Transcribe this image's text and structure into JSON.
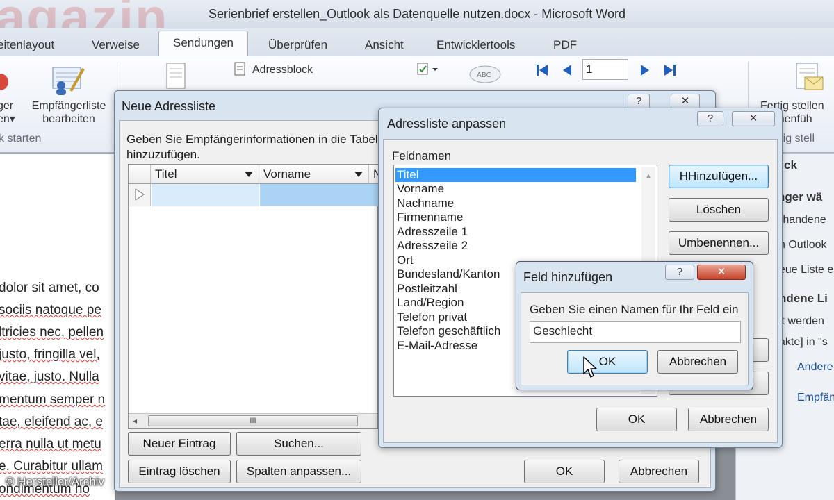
{
  "window": {
    "title": "Serienbrief erstellen_Outlook als Datenquelle nutzen.docx - Microsoft Word",
    "watermark": "agazin"
  },
  "tabs": [
    "eitenlayout",
    "Verweise",
    "Sendungen",
    "Überprüfen",
    "Ansicht",
    "Entwicklertools",
    "PDF"
  ],
  "ribbon": {
    "btn_left_1": "ger",
    "btn_left_2": "en",
    "edit_list_1": "Empfängerliste",
    "edit_list_2": "bearbeiten",
    "group_start": "k starten",
    "address_block": "Adressblock",
    "record_number": "1",
    "finish_1": "Fertig stellen",
    "finish_2": "mmenfüh",
    "group_finish": "ertig stell"
  },
  "document_lines": [
    "dolor sit amet, co",
    "sociis natoque pe",
    "ltricies nec, pellen",
    "justo, fringilla vel,",
    "vitae, justo. Nulla",
    "mentum semper n",
    "tae, eleifend ac, e",
    "erra nulla ut metu",
    "e. Curabitur ullam",
    "ondimentum ho"
  ],
  "credit": "© Hersteller/Archiv",
  "task_pane": {
    "header": "ruck",
    "section1": "nger wä",
    "line1": "rhandene",
    "line2": "n Outlook",
    "line3": "eue Liste e",
    "section2": "ndene Li",
    "line4": "it werden",
    "line5": "akte] in \"s",
    "link1": "Andere",
    "link2": "Empfän"
  },
  "dialog_new_list": {
    "title": "Neue Adressliste",
    "help": "?",
    "close": "✕",
    "instruction_1": "Geben Sie Empfängerinformationen in die Tabelle",
    "instruction_2": "hinzuzufügen.",
    "columns": [
      "Titel",
      "Vorname",
      "N"
    ],
    "scroll_mark": "III",
    "new_entry": "Neuer Eintrag",
    "search": "Suchen...",
    "delete_entry": "Eintrag löschen",
    "customize_columns": "Spalten anpassen...",
    "ok": "OK",
    "cancel": "Abbrechen"
  },
  "dialog_customize": {
    "title": "Adressliste anpassen",
    "help": "?",
    "close": "✕",
    "field_names_label": "Feldnamen",
    "fields": [
      "Titel",
      "Vorname",
      "Nachname",
      "Firmenname",
      "Adresszeile 1",
      "Adresszeile 2",
      "Ort",
      "Bundesland/Kanton",
      "Postleitzahl",
      "Land/Region",
      "Telefon privat",
      "Telefon geschäftlich",
      "E-Mail-Adresse"
    ],
    "add": "Hinzufügen...",
    "delete": "Löschen",
    "rename": "Umbenennen...",
    "ok": "OK",
    "cancel": "Abbrechen"
  },
  "dialog_add_field": {
    "title": "Feld hinzufügen",
    "help": "?",
    "close": "✕",
    "prompt": "Geben Sie einen Namen für Ihr Feld ein",
    "value": "Geschlecht",
    "ok": "OK",
    "cancel": "Abbrechen"
  }
}
